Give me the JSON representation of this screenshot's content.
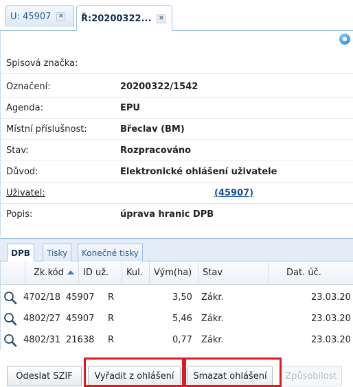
{
  "tabs": [
    {
      "label": "U: 45907",
      "active": false
    },
    {
      "label": "Ř:20200322...",
      "active": true
    }
  ],
  "tab_close_glyph": "✖",
  "fields": [
    {
      "label": "Spisová značka:",
      "value": ""
    },
    {
      "label": "Označení:",
      "value": "20200322/1542"
    },
    {
      "label": "Agenda:",
      "value": "EPU"
    },
    {
      "label": "Místní příslušnost:",
      "value": "Břeclav (BM)"
    },
    {
      "label": "Stav:",
      "value": "Rozpracováno"
    },
    {
      "label": "Důvod:",
      "value": "Elektronické ohlášení uživatele"
    },
    {
      "label": "Uživatel:",
      "value": "(45907)"
    },
    {
      "label": "Popis:",
      "value": "úprava hranic DPB"
    }
  ],
  "subtabs": [
    {
      "label": "DPB",
      "active": true
    },
    {
      "label": "Tisky",
      "active": false
    },
    {
      "label": "Konečné tisky",
      "active": false
    }
  ],
  "grid": {
    "columns": [
      "Zk.kód",
      "ID už.",
      "Kul.",
      "Vým(ha)",
      "Stav",
      "Dat. úč."
    ],
    "sorted_column": "Zk.kód",
    "rows": [
      [
        "4702/18",
        "45907",
        "R",
        "3,50",
        "Zákr.",
        "23.03.20"
      ],
      [
        "4802/27",
        "45907",
        "R",
        "5,46",
        "Zákr.",
        "23.03.20"
      ],
      [
        "4802/31",
        "21638",
        "R",
        "0,77",
        "Zákr.",
        "23.03.20"
      ]
    ]
  },
  "buttons": [
    {
      "label": "Odeslat SZIF",
      "enabled": true,
      "highlighted": false
    },
    {
      "label": "Vyřadit z ohlášení",
      "enabled": true,
      "highlighted": true
    },
    {
      "label": "Smazat ohlášení",
      "enabled": true,
      "highlighted": true
    },
    {
      "label": "Způsobilost",
      "enabled": false,
      "highlighted": false
    }
  ],
  "colors": {
    "accent": "#9cc1e6",
    "link": "#1a4f9c",
    "highlight": "#e0191e"
  },
  "icons": {
    "refresh": "refresh-icon",
    "row_detail": "magnifier-icon",
    "tab_close": "close-icon"
  }
}
